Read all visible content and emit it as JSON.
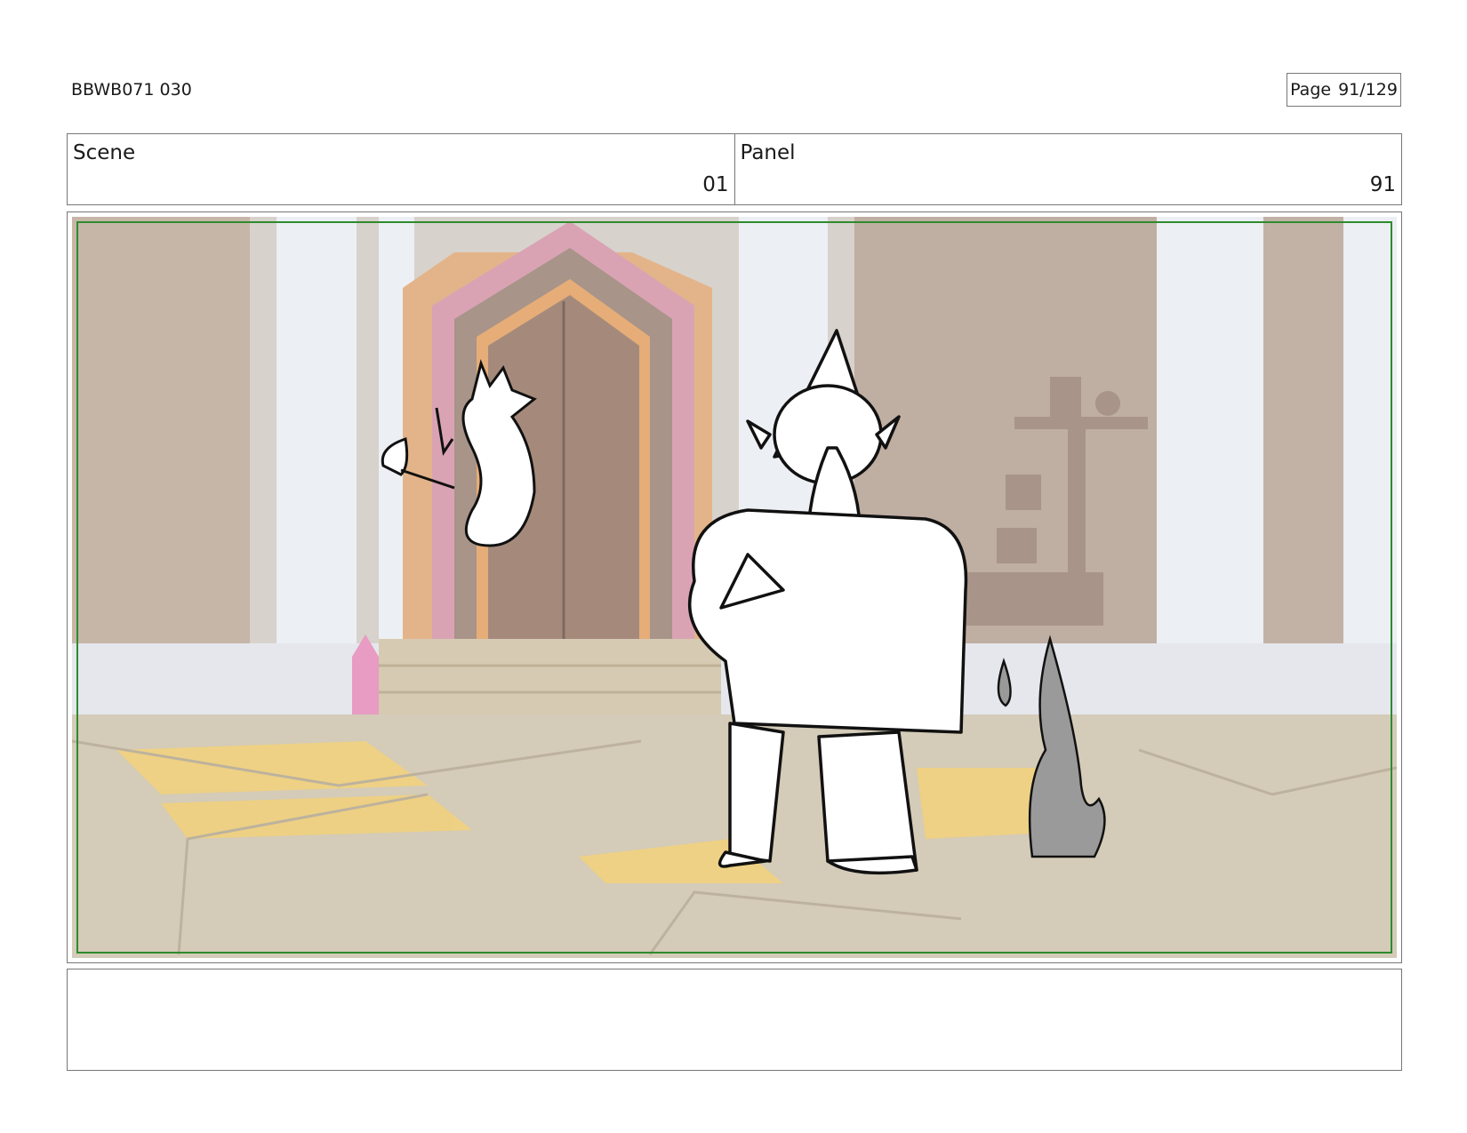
{
  "header": {
    "doc_id": "BBWB071 030",
    "page_label": "Page",
    "page_value": "91/129"
  },
  "info_row": {
    "scene_label": "Scene",
    "scene_value": "01",
    "panel_label": "Panel",
    "panel_value": "91"
  },
  "notes": {
    "text": ""
  },
  "colors": {
    "safe_frame": "#2e8b2e",
    "door_pink": "#d9a3b4",
    "door_orange": "#e6ad78",
    "floor_yellow": "#f2d27a",
    "crystal_pink": "#e89bc3",
    "flame_gray": "#9a9a9a"
  }
}
